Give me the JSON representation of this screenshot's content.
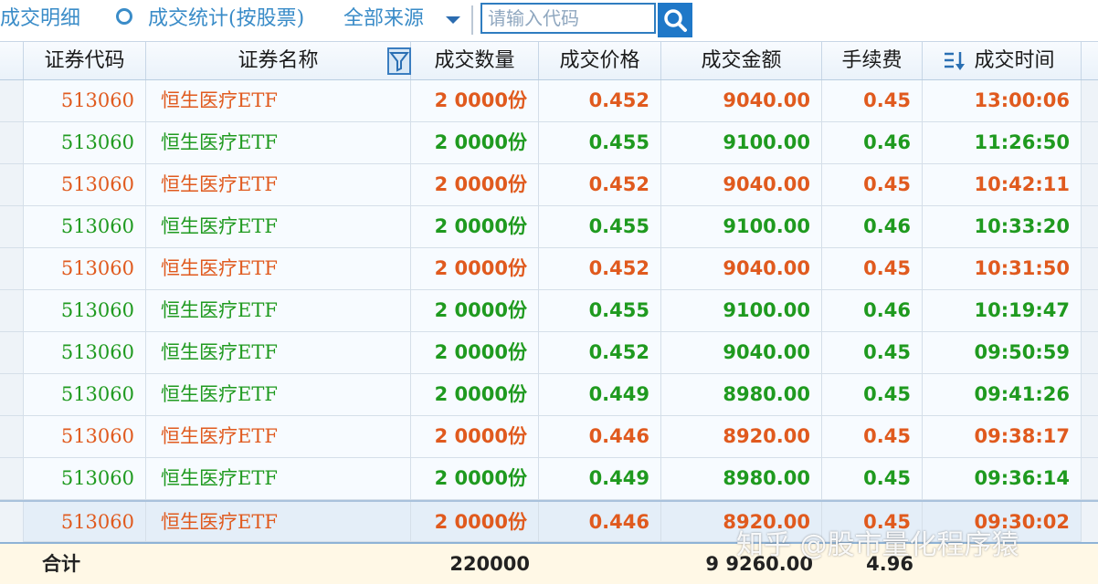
{
  "toolbar": {
    "details_tab": "成交明细",
    "stats_tab": "成交统计(按股票)",
    "source_dropdown": "全部来源",
    "search_placeholder": "请输入代码"
  },
  "table": {
    "columns": [
      "证券代码",
      "证券名称",
      "成交数量",
      "成交价格",
      "成交金额",
      "手续费",
      "成交时间"
    ],
    "rows": [
      {
        "code": "513060",
        "name": "恒生医疗ETF",
        "qty": "2 0000份",
        "price": "0.452",
        "amount": "9040.00",
        "fee": "0.45",
        "time": "13:00:06",
        "color": "red"
      },
      {
        "code": "513060",
        "name": "恒生医疗ETF",
        "qty": "2 0000份",
        "price": "0.455",
        "amount": "9100.00",
        "fee": "0.46",
        "time": "11:26:50",
        "color": "green"
      },
      {
        "code": "513060",
        "name": "恒生医疗ETF",
        "qty": "2 0000份",
        "price": "0.452",
        "amount": "9040.00",
        "fee": "0.45",
        "time": "10:42:11",
        "color": "red"
      },
      {
        "code": "513060",
        "name": "恒生医疗ETF",
        "qty": "2 0000份",
        "price": "0.455",
        "amount": "9100.00",
        "fee": "0.46",
        "time": "10:33:20",
        "color": "green"
      },
      {
        "code": "513060",
        "name": "恒生医疗ETF",
        "qty": "2 0000份",
        "price": "0.452",
        "amount": "9040.00",
        "fee": "0.45",
        "time": "10:31:50",
        "color": "red"
      },
      {
        "code": "513060",
        "name": "恒生医疗ETF",
        "qty": "2 0000份",
        "price": "0.455",
        "amount": "9100.00",
        "fee": "0.46",
        "time": "10:19:47",
        "color": "green"
      },
      {
        "code": "513060",
        "name": "恒生医疗ETF",
        "qty": "2 0000份",
        "price": "0.452",
        "amount": "9040.00",
        "fee": "0.45",
        "time": "09:50:59",
        "color": "green"
      },
      {
        "code": "513060",
        "name": "恒生医疗ETF",
        "qty": "2 0000份",
        "price": "0.449",
        "amount": "8980.00",
        "fee": "0.45",
        "time": "09:41:26",
        "color": "green"
      },
      {
        "code": "513060",
        "name": "恒生医疗ETF",
        "qty": "2 0000份",
        "price": "0.446",
        "amount": "8920.00",
        "fee": "0.45",
        "time": "09:38:17",
        "color": "red"
      },
      {
        "code": "513060",
        "name": "恒生医疗ETF",
        "qty": "2 0000份",
        "price": "0.449",
        "amount": "8980.00",
        "fee": "0.45",
        "time": "09:36:14",
        "color": "green"
      },
      {
        "code": "513060",
        "name": "恒生医疗ETF",
        "qty": "2 0000份",
        "price": "0.446",
        "amount": "8920.00",
        "fee": "0.45",
        "time": "09:30:02",
        "color": "red"
      }
    ]
  },
  "total": {
    "label": "合计",
    "qty": "220000",
    "amount": "9 9260.00",
    "fee": "4.96"
  },
  "watermark": "知乎 @股市量化程序猿",
  "colors": {
    "buy": "#e05a1e",
    "sell": "#1f9a1f",
    "accent": "#3a8cc8"
  }
}
